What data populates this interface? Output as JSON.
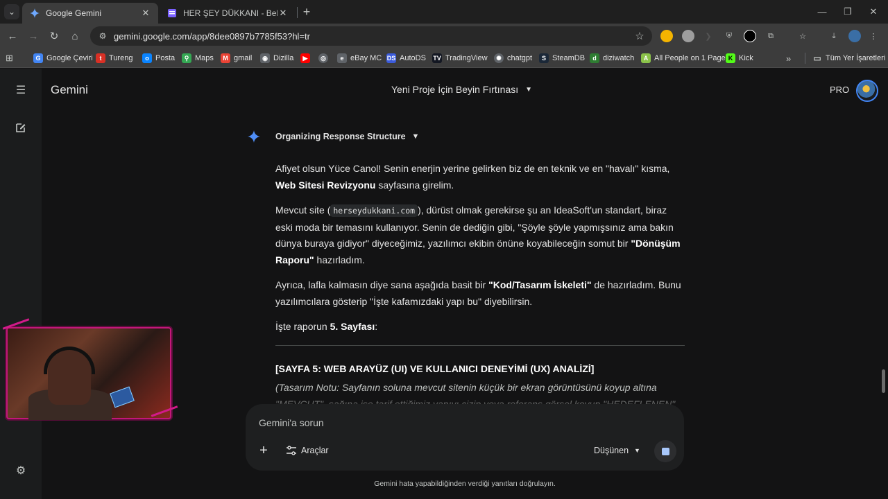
{
  "browser": {
    "tabs": [
      {
        "title": "Google Gemini",
        "active": true,
        "favicon": "gemini-spark-icon"
      },
      {
        "title": "HER ŞEY DÜKKANI - Belge",
        "active": false,
        "favicon": "docs-icon"
      }
    ],
    "url": "gemini.google.com/app/8dee0897b7785f53?hl=tr",
    "bookmarks": [
      {
        "label": "Google Çeviri",
        "icon": "translate-icon",
        "color": "#4285f4"
      },
      {
        "label": "Tureng",
        "icon": "tureng-icon",
        "color": "#d93025"
      },
      {
        "label": "Posta",
        "icon": "mail-icon",
        "color": "#0a84ff"
      },
      {
        "label": "Maps",
        "icon": "maps-icon",
        "color": "#34a853"
      },
      {
        "label": "gmail",
        "icon": "gmail-icon",
        "color": "#ea4335"
      },
      {
        "label": "Dizilla",
        "icon": "dizilla-icon",
        "color": "#9aa0a6"
      },
      {
        "label": "",
        "icon": "youtube-icon",
        "color": "#ff0000"
      },
      {
        "label": "",
        "icon": "globe-icon",
        "color": "#9aa0a6"
      },
      {
        "label": "eBay MC",
        "icon": "ebay-icon",
        "color": "#9aa0a6"
      },
      {
        "label": "AutoDS",
        "icon": "autods-icon",
        "color": "#3b5bdb"
      },
      {
        "label": "TradingView",
        "icon": "tradingview-icon",
        "color": "#131722"
      },
      {
        "label": "chatgpt",
        "icon": "chatgpt-icon",
        "color": "#9aa0a6"
      },
      {
        "label": "SteamDB",
        "icon": "steam-icon",
        "color": "#1b2838"
      },
      {
        "label": "diziwatch",
        "icon": "diziwatch-icon",
        "color": "#2e7d32"
      },
      {
        "label": "All People on 1 Page",
        "icon": "people-icon",
        "color": "#8bc34a"
      },
      {
        "label": "Kick",
        "icon": "kick-icon",
        "color": "#53fc18"
      }
    ],
    "all_bookmarks_label": "Tüm Yer İşaretleri"
  },
  "app": {
    "brand": "Gemini",
    "conversation_title": "Yeni Proje İçin Beyin Fırtınası",
    "plan_badge": "PRO",
    "thinking_label": "Organizing Response Structure",
    "response": {
      "p1_a": "Afiyet olsun Yüce Canol! Senin enerjin yerine gelirken biz de en teknik ve en \"havalı\" kısma, ",
      "p1_b": "Web Sitesi Revizyonu",
      "p1_c": " sayfasına girelim.",
      "p2_a": "Mevcut site (",
      "p2_code": "herseydukkani.com",
      "p2_b": "), dürüst olmak gerekirse şu an IdeaSoft'un standart, biraz eski moda bir temasını kullanıyor. Senin de dediğin gibi, \"Şöyle şöyle yapmışsınız ama bakın dünya buraya gidiyor\" diyeceğimiz, yazılımcı ekibin önüne koyabileceğin somut bir ",
      "p2_bold": "\"Dönüşüm Raporu\"",
      "p2_c": " hazırladım.",
      "p3_a": "Ayrıca, lafla kalmasın diye sana aşağıda basit bir ",
      "p3_bold": "\"Kod/Tasarım İskeleti\"",
      "p3_b": " de hazırladım. Bunu yazılımcılara gösterip \"İşte kafamızdaki yapı bu\" diyebilirsin.",
      "p4_a": "İşte raporun ",
      "p4_bold": "5. Sayfası",
      "p4_b": ":",
      "section_title": "[SAYFA 5: WEB ARAYÜZ (UI) VE KULLANICI DENEYİMİ (UX) ANALİZİ]",
      "note": "(Tasarım Notu: Sayfanın soluna mevcut sitenin küçük bir ekran görüntüsünü koyup altına \"MEVCUT\", sağına ise tarif ettiğimiz yapıyı çizip veya referans görsel koyup \"HEDEFLENEN\""
    },
    "composer": {
      "placeholder": "Gemini'a sorun",
      "tools_label": "Araçlar",
      "mode_label": "Düşünen"
    },
    "disclaimer": "Gemini hata yapabildiğinden verdiği yanıtları doğrulayın."
  },
  "colors": {
    "background": "#131314",
    "accent": "#a8c7fa",
    "webcam_frame": "#c2177a"
  }
}
